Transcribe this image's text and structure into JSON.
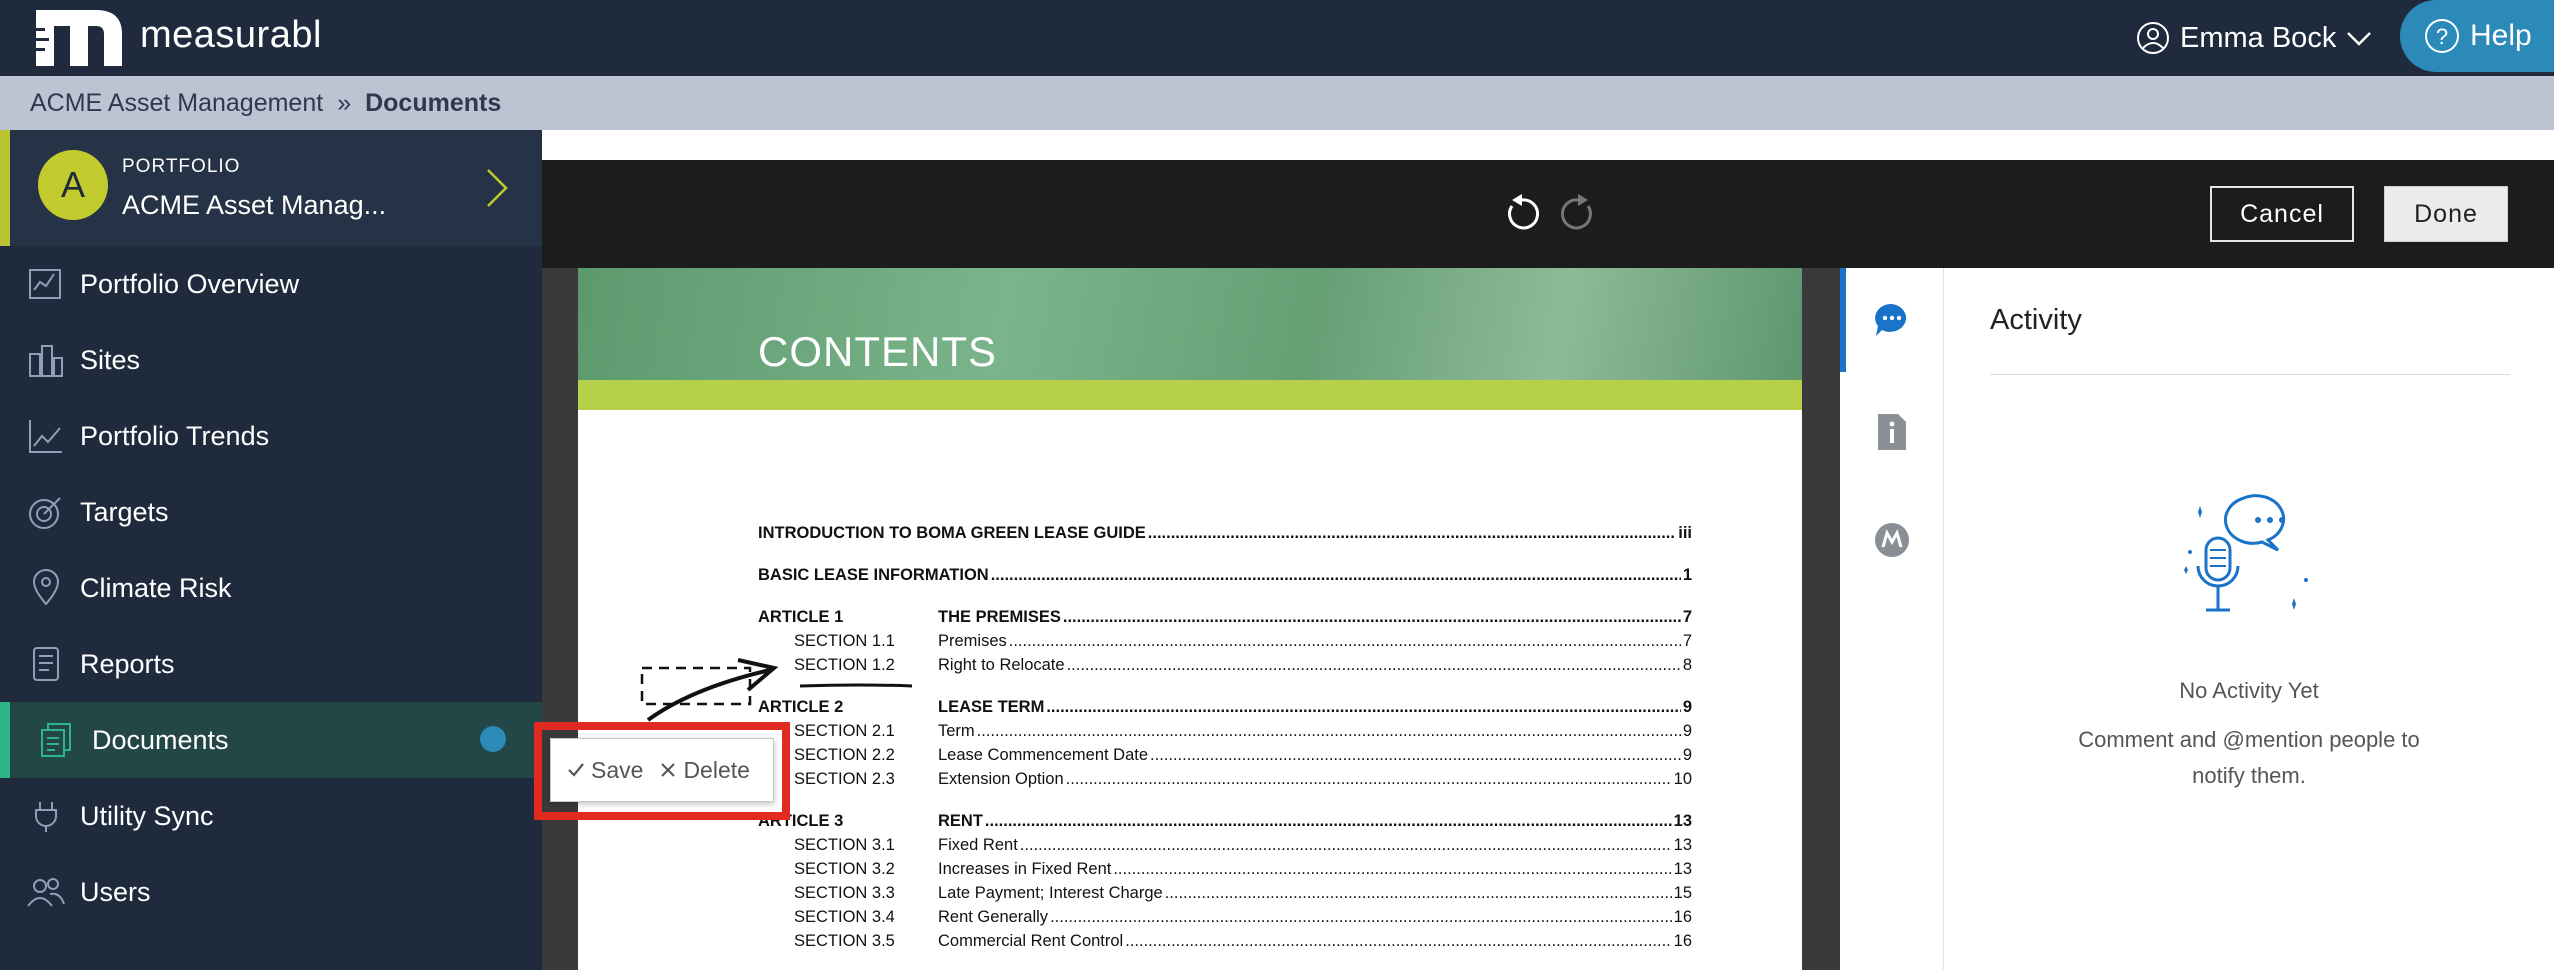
{
  "brand": {
    "name": "measurabl",
    "logo_letter": "m"
  },
  "user": {
    "name": "Emma Bock"
  },
  "help": {
    "label": "Help"
  },
  "breadcrumb": {
    "root": "ACME Asset Management",
    "separator": "»",
    "current": "Documents"
  },
  "sidebar": {
    "portfolio": {
      "initial": "A",
      "label": "PORTFOLIO",
      "name": "ACME Asset Manag..."
    },
    "items": [
      {
        "id": "portfolio-overview",
        "label": "Portfolio Overview",
        "icon": "chart-icon"
      },
      {
        "id": "sites",
        "label": "Sites",
        "icon": "buildings-icon"
      },
      {
        "id": "portfolio-trends",
        "label": "Portfolio Trends",
        "icon": "trend-icon"
      },
      {
        "id": "targets",
        "label": "Targets",
        "icon": "target-icon"
      },
      {
        "id": "climate-risk",
        "label": "Climate Risk",
        "icon": "map-pin-icon"
      },
      {
        "id": "reports",
        "label": "Reports",
        "icon": "scroll-icon"
      },
      {
        "id": "documents",
        "label": "Documents",
        "icon": "documents-icon",
        "active": true,
        "badge": true
      },
      {
        "id": "utility-sync",
        "label": "Utility Sync",
        "icon": "plug-icon"
      },
      {
        "id": "users",
        "label": "Users",
        "icon": "users-icon"
      }
    ]
  },
  "toolbar": {
    "cancel_label": "Cancel",
    "done_label": "Done"
  },
  "document": {
    "banner_title": "CONTENTS",
    "toc": [
      {
        "a": "",
        "title": "INTRODUCTION TO BOMA GREEN LEASE GUIDE",
        "page": "iii",
        "bold": true
      },
      {
        "a": "",
        "title": "BASIC LEASE INFORMATION",
        "page": "1",
        "bold": true
      },
      {
        "a": "ARTICLE 1",
        "title": "THE PREMISES",
        "page": "7",
        "bold": true
      },
      {
        "a": "SECTION 1.1",
        "title": "Premises",
        "page": "7",
        "bold": false
      },
      {
        "a": "SECTION 1.2",
        "title": "Right to Relocate",
        "page": "8",
        "bold": false
      },
      {
        "a": "ARTICLE 2",
        "title": "LEASE TERM",
        "page": "9",
        "bold": true
      },
      {
        "a": "SECTION 2.1",
        "title": "Term",
        "page": "9",
        "bold": false
      },
      {
        "a": "SECTION 2.2",
        "title": "Lease Commencement Date",
        "page": "9",
        "bold": false
      },
      {
        "a": "SECTION 2.3",
        "title": "Extension Option",
        "page": "10",
        "bold": false
      },
      {
        "a": "ARTICLE 3",
        "title": "RENT",
        "page": "13",
        "bold": true
      },
      {
        "a": "SECTION 3.1",
        "title": "Fixed Rent",
        "page": "13",
        "bold": false
      },
      {
        "a": "SECTION 3.2",
        "title": "Increases in Fixed Rent",
        "page": "13",
        "bold": false
      },
      {
        "a": "SECTION 3.3",
        "title": "Late Payment; Interest Charge",
        "page": "15",
        "bold": false
      },
      {
        "a": "SECTION 3.4",
        "title": "Rent Generally",
        "page": "16",
        "bold": false
      },
      {
        "a": "SECTION 3.5",
        "title": "Commercial Rent Control",
        "page": "16",
        "bold": false
      }
    ]
  },
  "annotation_popup": {
    "save_label": "Save",
    "delete_label": "Delete"
  },
  "activity": {
    "title": "Activity",
    "empty_title": "No Activity Yet",
    "empty_hint": "Comment and @mention people to notify them."
  },
  "colors": {
    "accent": "#2b8ab8",
    "highlight": "#e12a22",
    "sidebar": "#1f2a3c",
    "active_nav": "#2fb48a",
    "portfolio_accent": "#b8c432"
  }
}
